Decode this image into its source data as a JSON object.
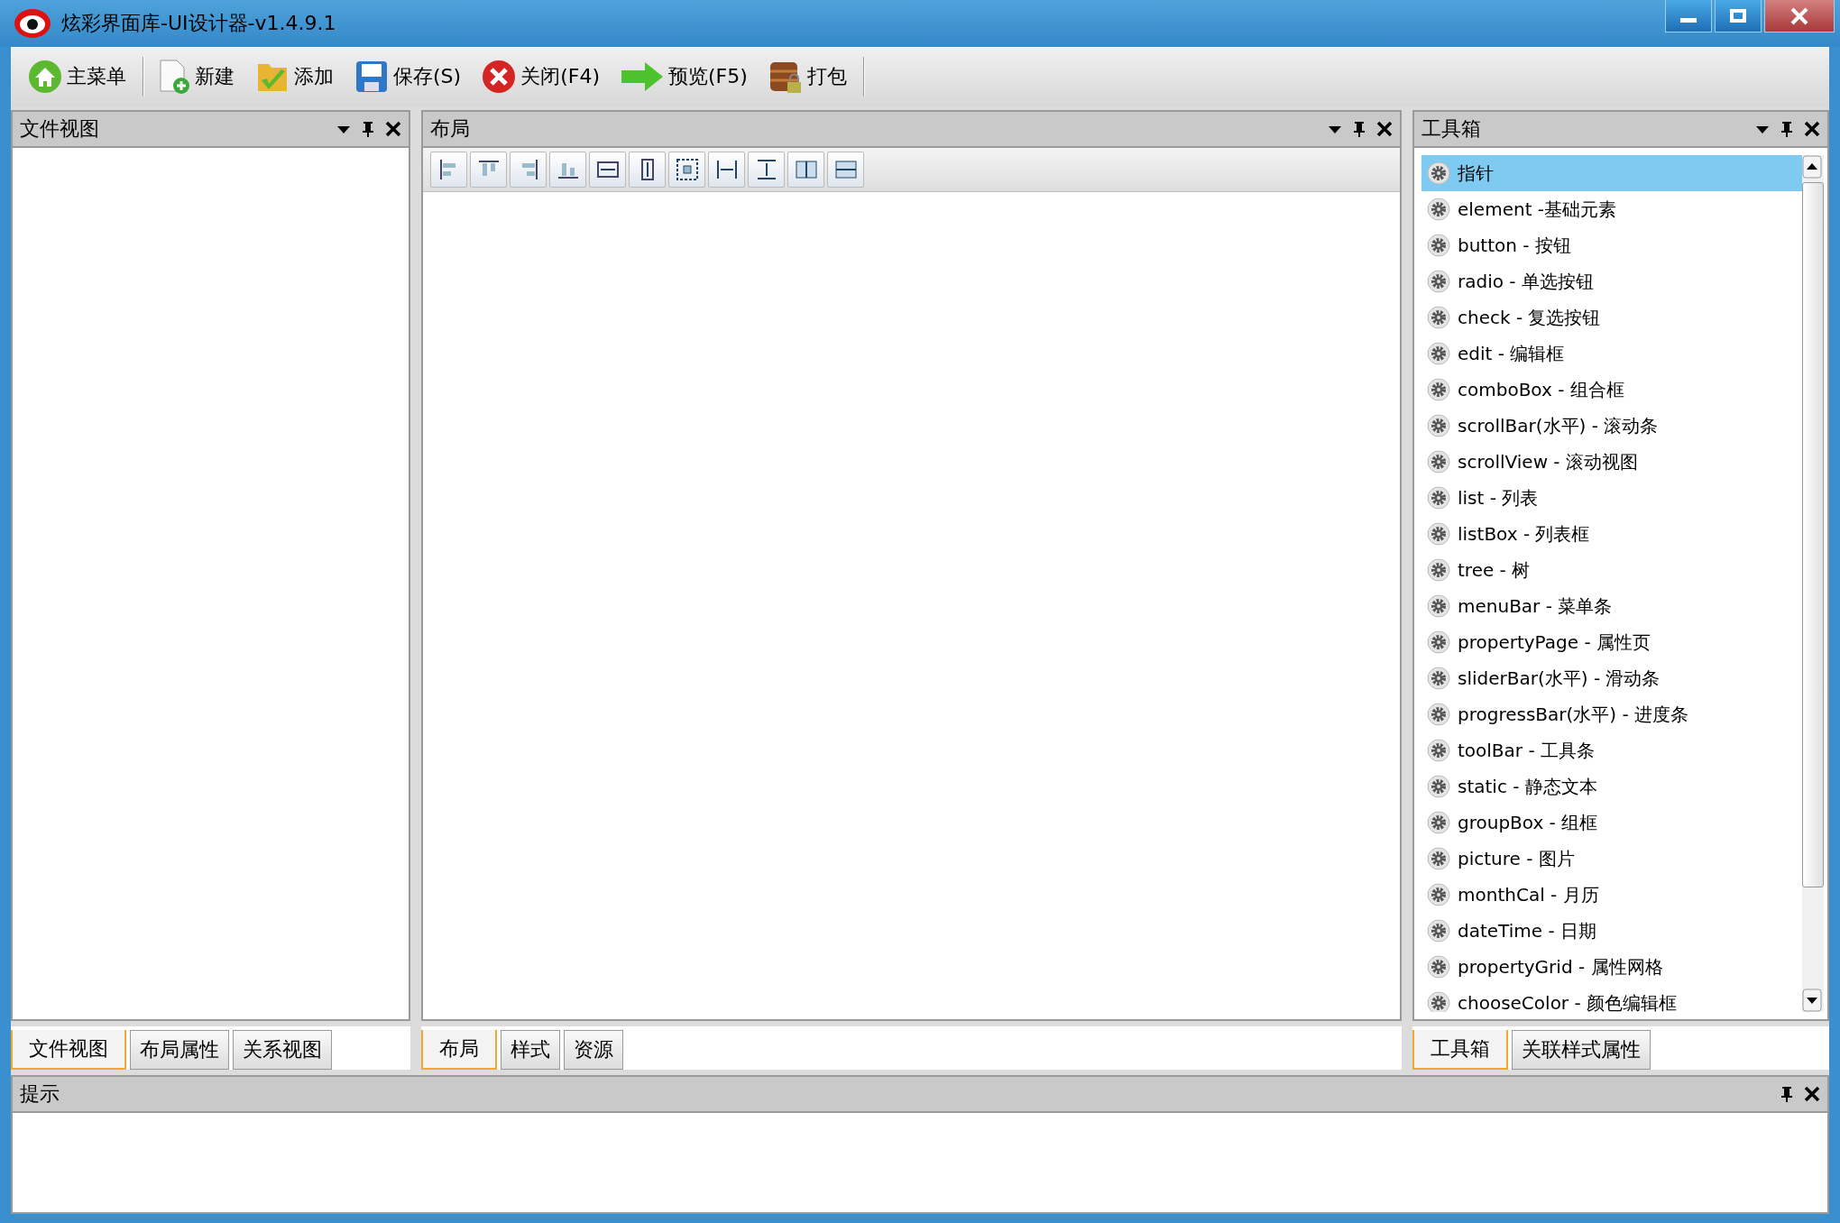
{
  "window": {
    "title": "炫彩界面库-UI设计器-v1.4.9.1"
  },
  "toolbar": [
    {
      "kind": "home",
      "label": "主菜单"
    },
    {
      "kind": "new",
      "label": "新建"
    },
    {
      "kind": "add",
      "label": "添加"
    },
    {
      "kind": "save",
      "label": "保存(S)"
    },
    {
      "kind": "close",
      "label": "关闭(F4)"
    },
    {
      "kind": "preview",
      "label": "预览(F5)"
    },
    {
      "kind": "pack",
      "label": "打包"
    }
  ],
  "file_view": {
    "title": "文件视图",
    "tabs": [
      {
        "label": "文件视图",
        "selected": true
      },
      {
        "label": "布局属性",
        "selected": false
      },
      {
        "label": "关系视图",
        "selected": false
      }
    ]
  },
  "layout": {
    "title": "布局",
    "tabs": [
      {
        "label": "布局",
        "selected": true
      },
      {
        "label": "样式",
        "selected": false
      },
      {
        "label": "资源",
        "selected": false
      }
    ]
  },
  "toolbox": {
    "title": "工具箱",
    "items": [
      {
        "label": "指针",
        "selected": true
      },
      {
        "label": "element -基础元素",
        "selected": false
      },
      {
        "label": "button - 按钮",
        "selected": false
      },
      {
        "label": "radio - 单选按钮",
        "selected": false
      },
      {
        "label": "check - 复选按钮",
        "selected": false
      },
      {
        "label": "edit - 编辑框",
        "selected": false
      },
      {
        "label": "comboBox - 组合框",
        "selected": false
      },
      {
        "label": "scrollBar(水平) - 滚动条",
        "selected": false
      },
      {
        "label": "scrollView - 滚动视图",
        "selected": false
      },
      {
        "label": "list - 列表",
        "selected": false
      },
      {
        "label": "listBox - 列表框",
        "selected": false
      },
      {
        "label": "tree - 树",
        "selected": false
      },
      {
        "label": "menuBar - 菜单条",
        "selected": false
      },
      {
        "label": "propertyPage - 属性页",
        "selected": false
      },
      {
        "label": "sliderBar(水平) - 滑动条",
        "selected": false
      },
      {
        "label": "progressBar(水平) - 进度条",
        "selected": false
      },
      {
        "label": "toolBar - 工具条",
        "selected": false
      },
      {
        "label": "static - 静态文本",
        "selected": false
      },
      {
        "label": "groupBox - 组框",
        "selected": false
      },
      {
        "label": "picture - 图片",
        "selected": false
      },
      {
        "label": "monthCal - 月历",
        "selected": false
      },
      {
        "label": "dateTime - 日期",
        "selected": false
      },
      {
        "label": "propertyGrid - 属性网格",
        "selected": false
      },
      {
        "label": "chooseColor - 颜色编辑框",
        "selected": false
      }
    ],
    "tabs": [
      {
        "label": "工具箱",
        "selected": true
      },
      {
        "label": "关联样式属性",
        "selected": false
      }
    ]
  },
  "hint": {
    "title": "提示"
  }
}
